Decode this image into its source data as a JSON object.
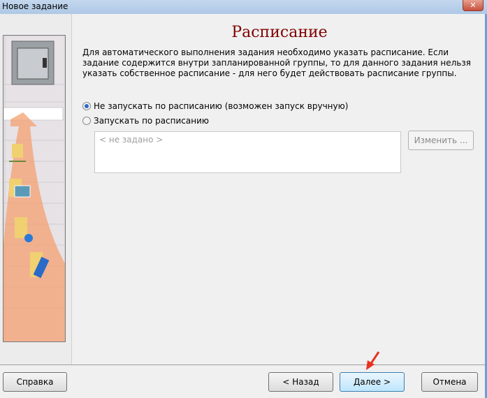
{
  "window": {
    "title": "Новое задание"
  },
  "page": {
    "heading": "Расписание",
    "description": "Для автоматического выполнения задания необходимо указать расписание. Если задание содержится внутри запланированной группы, то для данного задания нельзя указать собственное расписание - для него будет действовать расписание группы."
  },
  "options": [
    {
      "label": "Не запускать по расписанию (возможен запуск вручную)",
      "selected": true
    },
    {
      "label": "Запускать по расписанию",
      "selected": false
    }
  ],
  "schedule": {
    "value": "< не задано >",
    "edit_label": "Изменить ..."
  },
  "footer": {
    "help": "Справка",
    "back": "< Назад",
    "next": "Далее >",
    "cancel": "Отмена"
  },
  "colors": {
    "heading": "#800000",
    "accent_arrow": "#e8321e"
  }
}
